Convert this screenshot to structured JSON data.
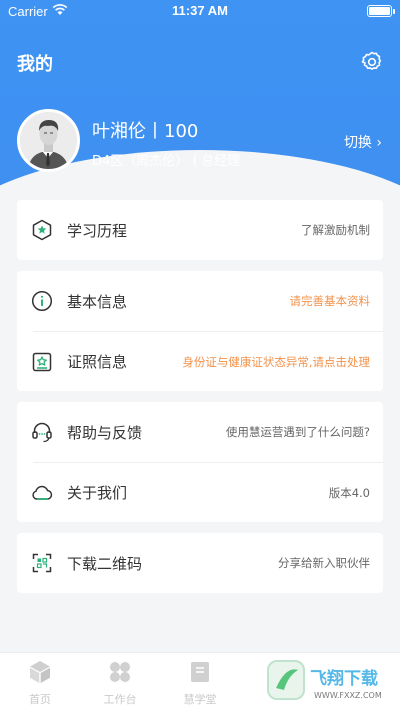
{
  "status_bar": {
    "carrier": "Carrier",
    "time": "11:37 AM"
  },
  "header": {
    "title": "我的"
  },
  "profile": {
    "name_line": "叶湘伦丨100",
    "dept_line": "D4区（周杰伦）丨总经理",
    "switch_label": "切换 ›"
  },
  "menu": {
    "learning": {
      "label": "学习历程",
      "value": "了解激励机制"
    },
    "basic_info": {
      "label": "基本信息",
      "value": "请完善基本资料"
    },
    "license": {
      "label": "证照信息",
      "value": "身份证与健康证状态异常,请点击处理"
    },
    "help": {
      "label": "帮助与反馈",
      "value": "使用慧运营遇到了什么问题?"
    },
    "about": {
      "label": "关于我们",
      "value": "版本4.0"
    },
    "qrcode": {
      "label": "下载二维码",
      "value": "分享给新入职伙伴"
    }
  },
  "tabbar": {
    "tabs": [
      {
        "label": "首页",
        "icon": "cube-icon"
      },
      {
        "label": "工作台",
        "icon": "grid-icon"
      },
      {
        "label": "慧学堂",
        "icon": "book-icon"
      }
    ]
  },
  "watermark": {
    "text": "飞翔下载",
    "url_text": "WWW.FXXZ.COM"
  },
  "colors": {
    "primary": "#3f8ff0",
    "accent_green": "#2db37a",
    "warning_orange": "#f2924a"
  }
}
